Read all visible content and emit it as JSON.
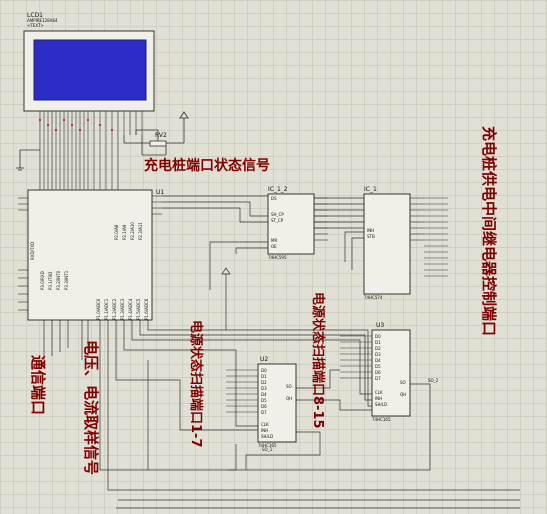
{
  "lcd": {
    "ref": "LCD1",
    "part": "AMPIRE128X64",
    "text": "<TEXT>"
  },
  "u1": {
    "ref": "U1"
  },
  "rv2": {
    "ref": "RV2"
  },
  "ic_1_2": {
    "ref": "IC_1_2",
    "part": "74HC595"
  },
  "ic_1": {
    "ref": "IC_1",
    "part": "74HC574"
  },
  "u2": {
    "ref": "U2",
    "part": "74HC165"
  },
  "u3": {
    "ref": "U3",
    "part": "74HC165"
  },
  "so_labels": {
    "so1": "SO_1",
    "so2": "SO_2"
  },
  "annotations": {
    "status_signal": "充电桩端口状态信号",
    "relay_control": "充电桩供电中间继电器控制端口",
    "scan_1_7": "电源状态扫描端口1-7",
    "scan_8_15": "电源状态扫描端口8-15",
    "comm_port": "通信端口",
    "va_signal": "电压、电流取样信号"
  }
}
